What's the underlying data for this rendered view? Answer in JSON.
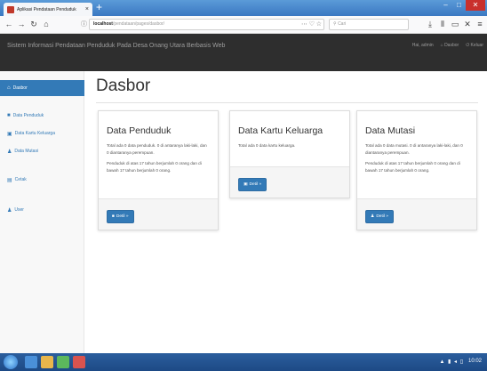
{
  "browser": {
    "tab_title": "Aplikasi Pendataan Penduduk",
    "tab_close": "×",
    "new_tab": "+",
    "win_min": "–",
    "win_max": "□",
    "win_close": "✕",
    "url_host": "localhost",
    "url_path": "/pendataan/pages/dasbor/",
    "search_placeholder": "Cari"
  },
  "header": {
    "title": "Sistem Informasi Pendataan Penduduk Pada Desa Onang Utara Berbasis Web",
    "user_link": "Hai, admin",
    "home_link": "Dasbor",
    "logout_link": "Keluar"
  },
  "sidebar": {
    "items": [
      {
        "label": "Dasbor",
        "icon": "home-icon"
      },
      {
        "label": "Data Penduduk",
        "icon": "users-icon"
      },
      {
        "label": "Data Kartu Keluarga",
        "icon": "card-icon"
      },
      {
        "label": "Data Mutasi",
        "icon": "user-move-icon"
      },
      {
        "label": "Cetak",
        "icon": "print-icon"
      },
      {
        "label": "User",
        "icon": "user-icon"
      }
    ]
  },
  "main": {
    "title": "Dasbor",
    "cards": [
      {
        "title": "Data Penduduk",
        "text1": "Total ada 0 data penduduk. 0 di antaranya laki-laki, dan 0 diantaranya perempuan.",
        "text2": "Penduduk di atas 17 tahun berjumlah 0 orang dan di bawah 17 tahun berjumlah 0 orang.",
        "button": "Detil »"
      },
      {
        "title": "Data Kartu Keluarga",
        "text1": "Total ada 0 data kartu keluarga.",
        "text2": "",
        "button": "Detil »"
      },
      {
        "title": "Data Mutasi",
        "text1": "Total ada 0 data mutasi. 0 di antaranya laki-laki, dan 0 diantaranya perempuan.",
        "text2": "Penduduk di atas 17 tahun berjumlah 0 orang dan di bawah 17 tahun berjumlah 0 orang.",
        "button": "Detil »"
      }
    ]
  },
  "taskbar": {
    "clock": "10:02"
  },
  "colors": {
    "primary": "#337ab7",
    "header_bg": "#2e2e2e",
    "taskbar": "#1d4a85"
  }
}
